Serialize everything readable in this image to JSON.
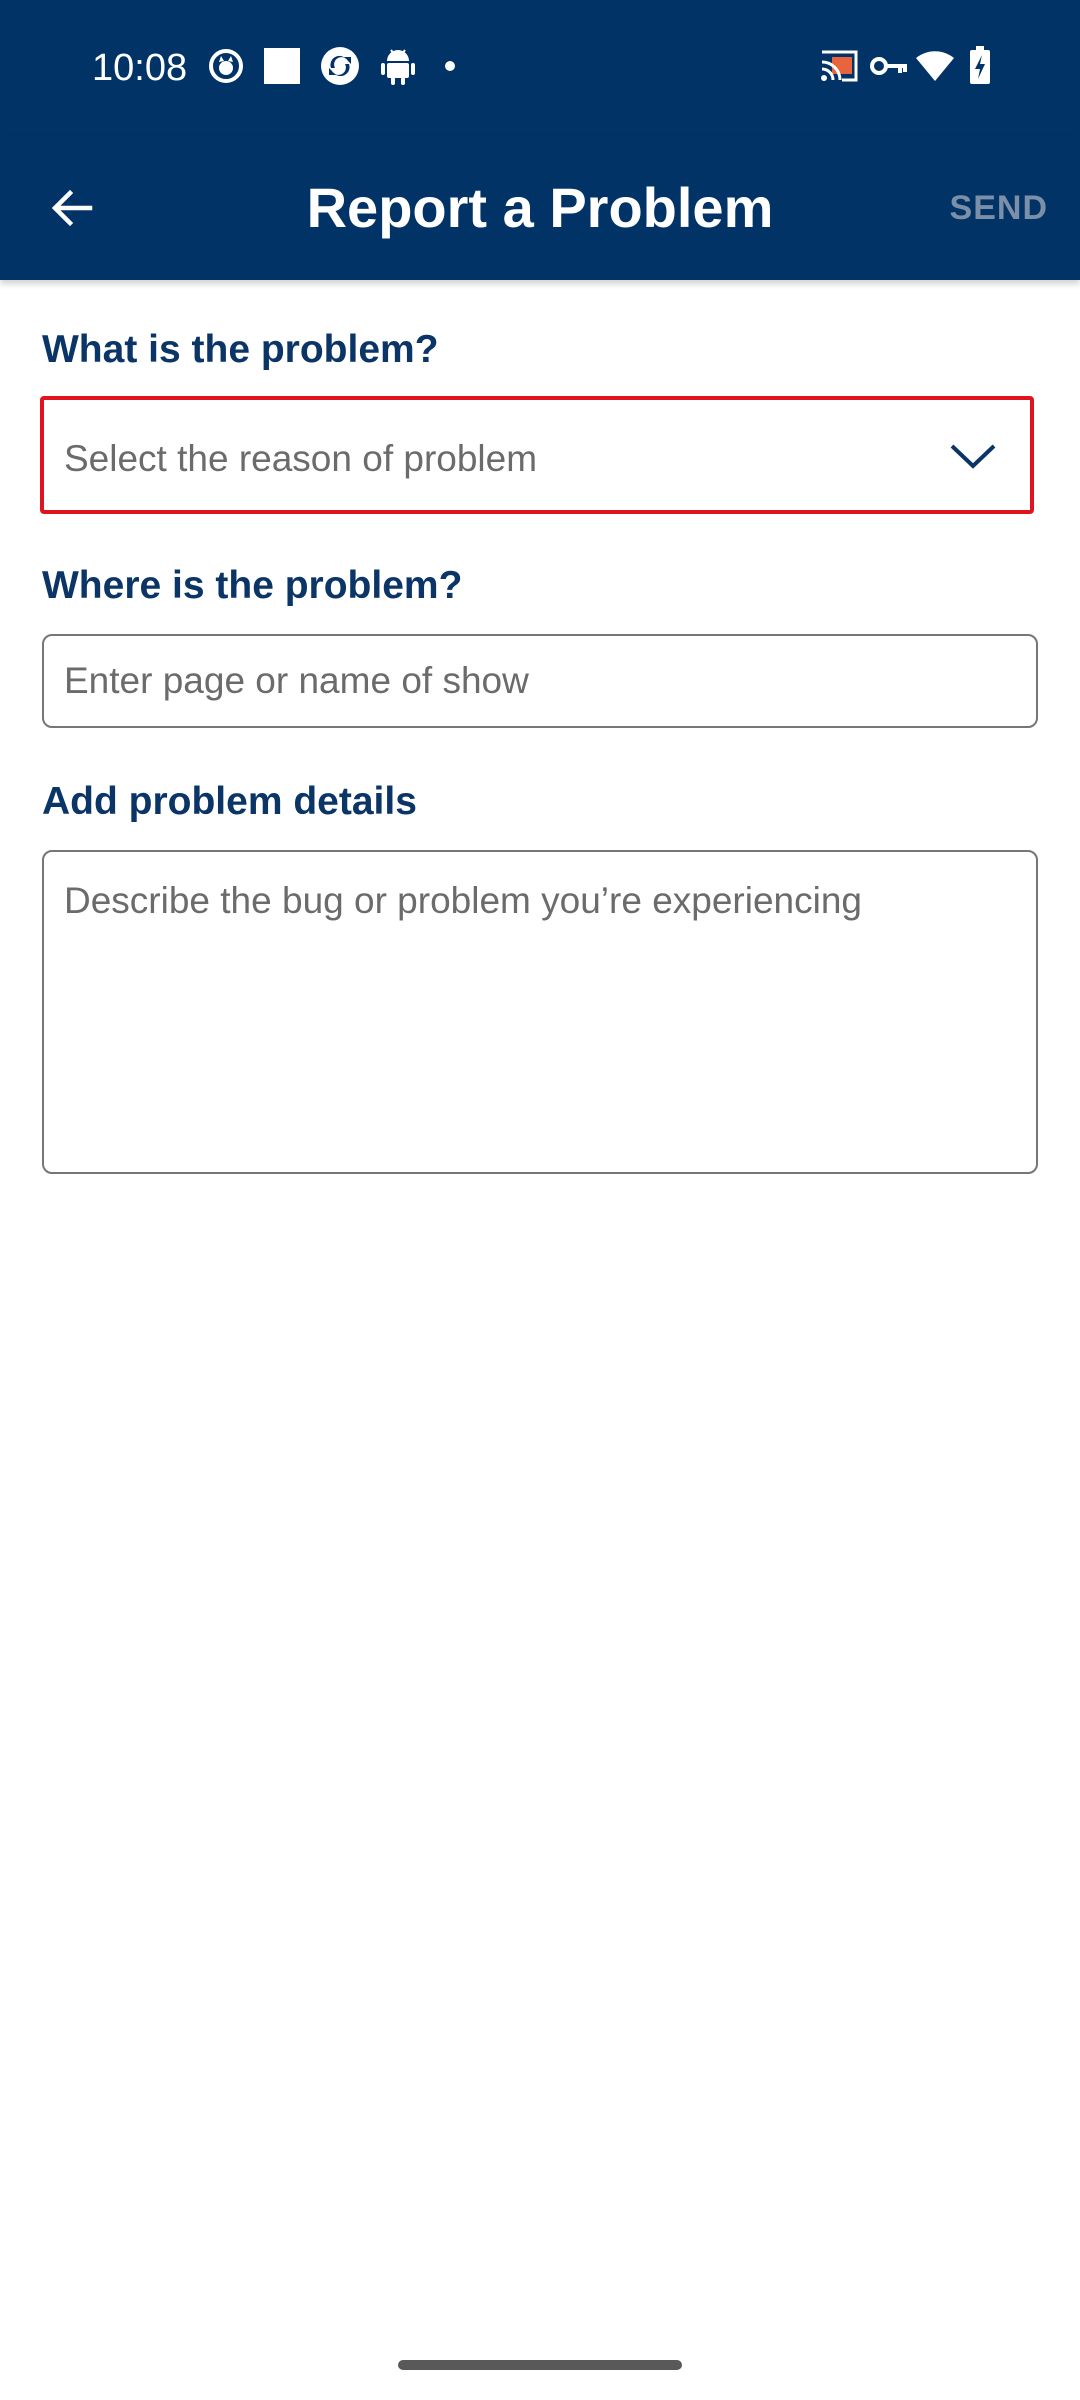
{
  "status_bar": {
    "time": "10:08",
    "left_icons": [
      "cat-notification-icon",
      "square-notification-icon",
      "sync-notification-icon",
      "android-notification-icon",
      "more-dot-icon"
    ],
    "right_icons": [
      "cast-icon",
      "vpn-key-icon",
      "wifi-icon",
      "battery-charging-icon"
    ]
  },
  "app_bar": {
    "back_icon": "arrow-back-icon",
    "title": "Report a Problem",
    "send_label": "SEND"
  },
  "form": {
    "problem": {
      "label": "What is the problem?",
      "placeholder": "Select the reason of problem",
      "dropdown_icon": "chevron-down-icon"
    },
    "location": {
      "label": "Where is the problem?",
      "placeholder": "Enter page or name of show"
    },
    "details": {
      "label": "Add problem details",
      "placeholder": "Describe the bug or problem you’re experiencing"
    }
  },
  "colors": {
    "primary": "#023366",
    "label": "#0b3467",
    "send_disabled": "#7b8fa8",
    "highlight_border": "#e0141e"
  }
}
